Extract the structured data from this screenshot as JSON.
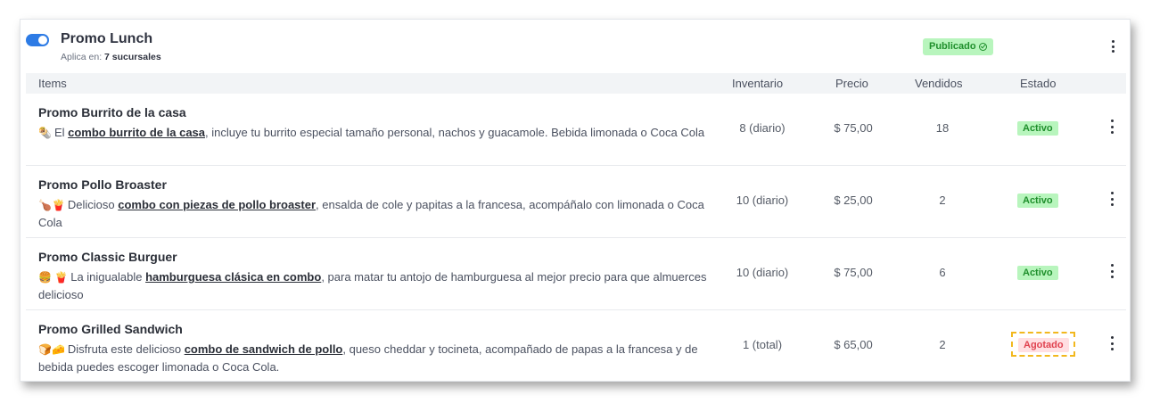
{
  "header": {
    "title": "Promo Lunch",
    "applies_prefix": "Aplica en:",
    "applies_value": "7 sucursales",
    "status_badge": "Publicado"
  },
  "columns": {
    "items": "Items",
    "inventory": "Inventario",
    "price": "Precio",
    "sold": "Vendidos",
    "state": "Estado"
  },
  "rows": [
    {
      "name": "Promo Burrito de la casa",
      "emoji": "🌯",
      "desc_prefix": "El",
      "desc_link": "combo burrito de la casa",
      "desc_suffix": ", incluye tu burrito especial tamaño personal, nachos y guacamole. Bebida limonada o Coca Cola",
      "inventory": "8 (diario)",
      "price": "$ 75,00",
      "sold": "18",
      "status": "Activo"
    },
    {
      "name": "Promo Pollo Broaster",
      "emoji": "🍗🍟",
      "desc_prefix": "Delicioso",
      "desc_link": "combo con piezas de pollo broaster",
      "desc_suffix": ", ensalda de cole y papitas a la francesa, acompáñalo con limonada o Coca Cola",
      "inventory": "10 (diario)",
      "price": "$ 25,00",
      "sold": "2",
      "status": "Activo"
    },
    {
      "name": "Promo Classic Burguer",
      "emoji": "🍔 🍟",
      "desc_prefix": "La inigualable",
      "desc_link": "hamburguesa clásica en combo",
      "desc_suffix": ", para matar tu antojo de hamburguesa al mejor precio para que almuerces delicioso",
      "inventory": "10 (diario)",
      "price": "$ 75,00",
      "sold": "6",
      "status": "Activo"
    },
    {
      "name": "Promo Grilled Sandwich",
      "emoji": "🍞🧀",
      "desc_prefix": "Disfruta este delicioso",
      "desc_link": "combo de sandwich de pollo",
      "desc_suffix": ", queso cheddar y tocineta, acompañado de papas a la francesa y de bebida puedes escoger limonada o Coca Cola.",
      "inventory": "1 (total)",
      "price": "$ 65,00",
      "sold": "2",
      "status": "Agotado"
    }
  ],
  "colors": {
    "toggle": "#2d7be5",
    "active_bg": "#b8f5bd",
    "active_text": "#1f8f2c",
    "soldout_bg": "#ffdfe2",
    "soldout_text": "#e0424f",
    "highlight": "#f2b81e"
  },
  "icons": [
    "toggle-switch",
    "check-circle-icon",
    "kebab-menu-icon"
  ]
}
